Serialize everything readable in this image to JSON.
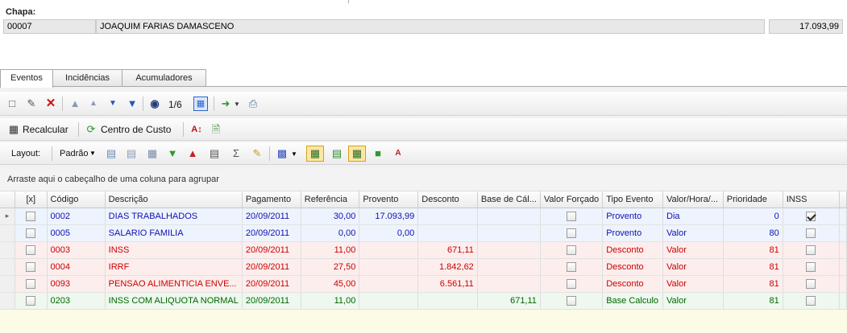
{
  "header": {
    "chapa_label": "Chapa:",
    "code": "00007",
    "name": "JOAQUIM FARIAS DAMASCENO",
    "value": "17.093,99"
  },
  "tabs": [
    {
      "label": "Eventos",
      "active": true
    },
    {
      "label": "Incidências",
      "active": false
    },
    {
      "label": "Acumuladores",
      "active": false
    }
  ],
  "toolbar1": {
    "record_position": "1/6",
    "icons": [
      "new-icon",
      "edit-icon",
      "delete-icon",
      "first-record-icon",
      "previous-record-icon",
      "next-record-icon",
      "last-record-icon",
      "find-icon",
      "calendar-grid-icon",
      "export-icon",
      "print-icon"
    ]
  },
  "toolbar2": {
    "recalcular": "Recalcular",
    "centro_custo": "Centro de Custo"
  },
  "toolbar3": {
    "layout_label": "Layout:",
    "padrao": "Padrão"
  },
  "grid": {
    "group_hint": "Arraste aqui o cabeçalho de uma coluna para agrupar",
    "columns": [
      "[x]",
      "Código",
      "Descrição",
      "Pagamento",
      "Referência",
      "Provento",
      "Desconto",
      "Base de Cál...",
      "Valor Forçado",
      "Tipo Evento",
      "Valor/Hora/...",
      "Prioridade",
      "INSS"
    ],
    "rows": [
      {
        "style": "blue",
        "selected": false,
        "codigo": "0002",
        "descricao": "DIAS TRABALHADOS",
        "pagamento": "20/09/2011",
        "referencia": "30,00",
        "provento": "17.093,99",
        "desconto": "",
        "base": "",
        "forcado": false,
        "tipo": "Provento",
        "valor_hora": "Dia",
        "prioridade": "0",
        "inss": true,
        "current": true
      },
      {
        "style": "blue",
        "selected": false,
        "codigo": "0005",
        "descricao": "SALARIO FAMILIA",
        "pagamento": "20/09/2011",
        "referencia": "0,00",
        "provento": "0,00",
        "desconto": "",
        "base": "",
        "forcado": false,
        "tipo": "Provento",
        "valor_hora": "Valor",
        "prioridade": "80",
        "inss": false,
        "current": false
      },
      {
        "style": "red",
        "selected": false,
        "codigo": "0003",
        "descricao": "INSS",
        "pagamento": "20/09/2011",
        "referencia": "11,00",
        "provento": "",
        "desconto": "671,11",
        "base": "",
        "forcado": false,
        "tipo": "Desconto",
        "valor_hora": "Valor",
        "prioridade": "81",
        "inss": false,
        "current": false
      },
      {
        "style": "red",
        "selected": false,
        "codigo": "0004",
        "descricao": "IRRF",
        "pagamento": "20/09/2011",
        "referencia": "27,50",
        "provento": "",
        "desconto": "1.842,62",
        "base": "",
        "forcado": false,
        "tipo": "Desconto",
        "valor_hora": "Valor",
        "prioridade": "81",
        "inss": false,
        "current": false
      },
      {
        "style": "red",
        "selected": false,
        "codigo": "0093",
        "descricao": "PENSAO ALIMENTICIA ENVE...",
        "pagamento": "20/09/2011",
        "referencia": "45,00",
        "provento": "",
        "desconto": "6.561,11",
        "base": "",
        "forcado": false,
        "tipo": "Desconto",
        "valor_hora": "Valor",
        "prioridade": "81",
        "inss": false,
        "current": false
      },
      {
        "style": "green",
        "selected": false,
        "codigo": "0203",
        "descricao": "INSS COM ALIQUOTA NORMAL",
        "pagamento": "20/09/2011",
        "referencia": "11,00",
        "provento": "",
        "desconto": "",
        "base": "671,11",
        "forcado": false,
        "tipo": "Base Calculo",
        "valor_hora": "Valor",
        "prioridade": "81",
        "inss": false,
        "current": false
      }
    ]
  },
  "colors": {
    "provento": "#1010b0",
    "desconto": "#cc0000",
    "base": "#006600"
  }
}
